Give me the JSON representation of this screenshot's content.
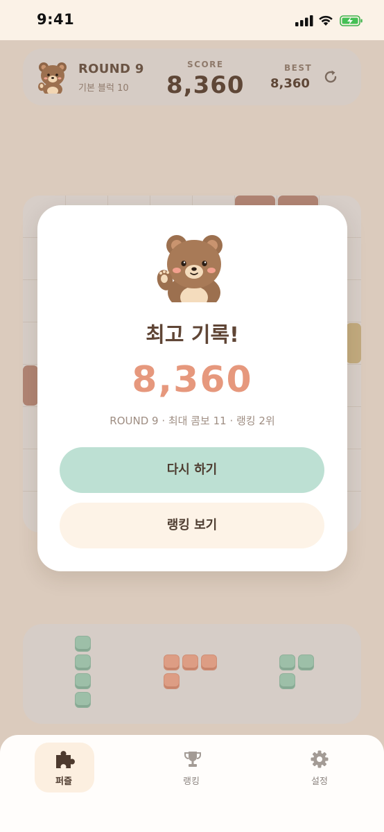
{
  "status_bar": {
    "time": "9:41"
  },
  "header": {
    "round_title": "ROUND 9",
    "round_subtitle": "기본 블럭 10",
    "score_label": "SCORE",
    "score_value": "8,360",
    "best_label": "BEST",
    "best_value": "8,360",
    "refresh_icon": "refresh-icon",
    "avatar_icon": "bear-avatar-icon"
  },
  "modal": {
    "mascot_icon": "waving-bear-icon",
    "title": "최고 기록!",
    "score": "8,360",
    "info": "ROUND 9 · 최대 콤보 11 · 랭킹 2위",
    "primary_button": "다시 하기",
    "secondary_button": "랭킹 보기"
  },
  "tabs": [
    {
      "label": "퍼즐",
      "icon": "puzzle-icon",
      "active": true
    },
    {
      "label": "랭킹",
      "icon": "trophy-icon",
      "active": false
    },
    {
      "label": "설정",
      "icon": "gear-icon",
      "active": false
    }
  ],
  "colors": {
    "accent_score": "#e6987d",
    "primary_button": "#bde0d3",
    "secondary_button": "#fdf3e7",
    "background": "#dbcbbd"
  }
}
